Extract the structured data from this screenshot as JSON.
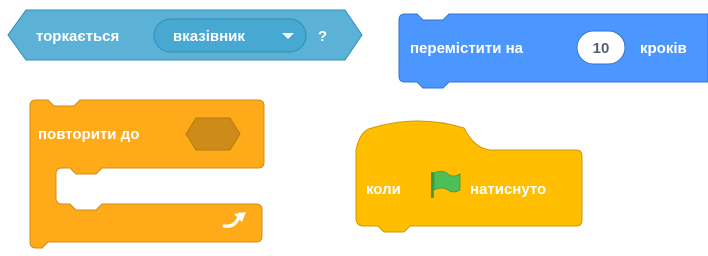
{
  "palette": {
    "sensing": "#5cb1d6",
    "sensing_dark": "#2e8eb8",
    "sensing_menu": "#47a8d1",
    "motion": "#4c97ff",
    "motion_dark": "#3373cc",
    "control": "#ffab19",
    "control_dark": "#cf8b17",
    "events": "#ffbf00",
    "events_dark": "#cc9900",
    "flag_green": "#4cbf56",
    "input_fill": "#ffffff",
    "input_text": "#575e75"
  },
  "blocks": {
    "touching": {
      "label": "торкається",
      "menu_value": "вказівник",
      "menu_arrow_icon": "dropdown-arrow-icon",
      "suffix": "?"
    },
    "move": {
      "label": "перемістити на",
      "steps_value": "10",
      "unit": "кроків"
    },
    "repeat_until": {
      "label": "повторити до",
      "loop_icon": "loop-arrow-icon"
    },
    "when_flag": {
      "prefix": "коли",
      "flag_icon": "green-flag-icon",
      "suffix": "натиснуто"
    }
  }
}
